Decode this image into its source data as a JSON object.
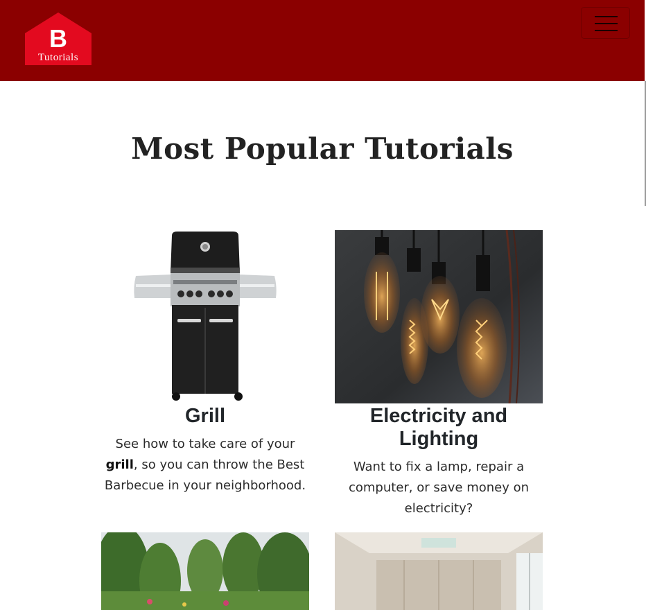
{
  "brand": {
    "letter": "B",
    "name": "Tutorials",
    "colors": {
      "header": "#8b0000",
      "logo": "#e30a1f"
    }
  },
  "nav": {
    "toggle_icon": "hamburger-menu-icon"
  },
  "page": {
    "title": "Most Popular Tutorials"
  },
  "cards": [
    {
      "title": "Grill",
      "text_before": "See how to take care of your ",
      "text_bold": "grill",
      "text_after": ", so you can throw the Best Barbecue in your neighborhood."
    },
    {
      "title": "Electricity and Lighting",
      "text": "Want to fix a lamp, repair a computer, or save money on electricity?"
    }
  ]
}
